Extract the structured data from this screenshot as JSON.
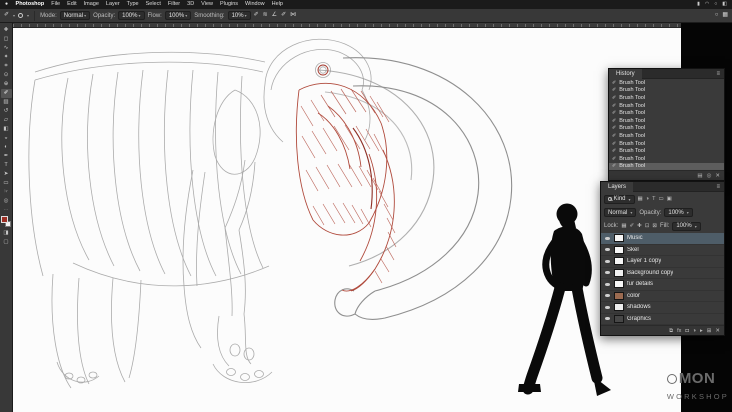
{
  "ui": {
    "caret": "▾",
    "panel_menu": "≡",
    "apple": "●"
  },
  "menu_bar": {
    "items": [
      "Photoshop",
      "File",
      "Edit",
      "Image",
      "Layer",
      "Type",
      "Select",
      "Filter",
      "3D",
      "View",
      "Plugins",
      "Window",
      "Help"
    ],
    "status_icons": [
      {
        "name": "battery-icon",
        "glyph": "▮"
      },
      {
        "name": "wifi-icon",
        "glyph": "◠"
      },
      {
        "name": "search-icon",
        "glyph": "○"
      },
      {
        "name": "control-center-icon",
        "glyph": "◧"
      }
    ]
  },
  "options_bar": {
    "tool_icon_glyph": "✐",
    "mode_label": "Mode:",
    "mode_value": "Normal",
    "opacity_label": "Opacity:",
    "opacity_value": "100%",
    "flow_label": "Flow:",
    "flow_value": "100%",
    "smoothing_label": "Smoothing:",
    "smoothing_value": "10%",
    "trailing_icons": [
      {
        "name": "pen-pressure-opacity-icon",
        "glyph": "✐"
      },
      {
        "name": "airbrush-icon",
        "glyph": "≋"
      },
      {
        "name": "brush-angle-icon",
        "glyph": "∠"
      },
      {
        "name": "pen-pressure-size-icon",
        "glyph": "✐"
      },
      {
        "name": "paint-symmetry-icon",
        "glyph": "⋈"
      }
    ],
    "right_icons": [
      {
        "name": "search-icon",
        "glyph": "○"
      },
      {
        "name": "workspace-switcher-icon",
        "glyph": "▦"
      }
    ]
  },
  "toolbar": {
    "tools": [
      {
        "name": "move-tool",
        "glyph": "✚"
      },
      {
        "name": "marquee-tool",
        "glyph": "◻"
      },
      {
        "name": "lasso-tool",
        "glyph": "∿"
      },
      {
        "name": "quick-selection-tool",
        "glyph": "✦"
      },
      {
        "name": "crop-tool",
        "glyph": "⌗"
      },
      {
        "name": "eyedropper-tool",
        "glyph": "⊙"
      },
      {
        "name": "healing-brush-tool",
        "glyph": "⊕"
      },
      {
        "name": "brush-tool",
        "glyph": "✐",
        "selected": true
      },
      {
        "name": "clone-stamp-tool",
        "glyph": "▨"
      },
      {
        "name": "history-brush-tool",
        "glyph": "↺"
      },
      {
        "name": "eraser-tool",
        "glyph": "▱"
      },
      {
        "name": "gradient-tool",
        "glyph": "◧"
      },
      {
        "name": "blur-tool",
        "glyph": "◒"
      },
      {
        "name": "dodge-tool",
        "glyph": "◐"
      },
      {
        "name": "pen-tool",
        "glyph": "✒"
      },
      {
        "name": "type-tool",
        "glyph": "T"
      },
      {
        "name": "path-selection-tool",
        "glyph": "➤"
      },
      {
        "name": "shape-tool",
        "glyph": "▭"
      },
      {
        "name": "hand-tool",
        "glyph": "☞"
      },
      {
        "name": "zoom-tool",
        "glyph": "◎"
      }
    ],
    "more_glyph": "⋯",
    "foreground_color": "#9c2f25",
    "background_color": "#f2f2f2",
    "extra_icons": [
      {
        "name": "quick-mask-icon",
        "glyph": "◨"
      },
      {
        "name": "screen-mode-icon",
        "glyph": "▢"
      }
    ]
  },
  "history_panel": {
    "title": "History",
    "entry_icon": "✐",
    "entries": [
      "Brush Tool",
      "Brush Tool",
      "Brush Tool",
      "Brush Tool",
      "Brush Tool",
      "Brush Tool",
      "Brush Tool",
      "Brush Tool",
      "Brush Tool",
      "Brush Tool",
      "Brush Tool",
      "Brush Tool"
    ],
    "footer_icons": [
      {
        "name": "new-document-from-state-icon",
        "glyph": "▤"
      },
      {
        "name": "new-snapshot-icon",
        "glyph": "◎"
      },
      {
        "name": "delete-state-icon",
        "glyph": "✕"
      }
    ]
  },
  "layers_panel": {
    "title": "Layers",
    "filter_label": "Kind",
    "filter_icons": [
      {
        "name": "filter-pixel-layers-icon",
        "glyph": "▦"
      },
      {
        "name": "filter-adjustment-layers-icon",
        "glyph": "◑"
      },
      {
        "name": "filter-type-layers-icon",
        "glyph": "T"
      },
      {
        "name": "filter-shape-layers-icon",
        "glyph": "▭"
      },
      {
        "name": "filter-smart-objects-icon",
        "glyph": "▣"
      }
    ],
    "blend_mode": "Normal",
    "opacity_label": "Opacity:",
    "opacity_value": "100%",
    "lock_label": "Lock:",
    "lock_icons": [
      {
        "name": "lock-transparent-pixels-icon",
        "glyph": "▦"
      },
      {
        "name": "lock-image-pixels-icon",
        "glyph": "✐"
      },
      {
        "name": "lock-position-icon",
        "glyph": "✚"
      },
      {
        "name": "lock-artboard-icon",
        "glyph": "⊡"
      },
      {
        "name": "lock-all-icon",
        "glyph": "⊠"
      }
    ],
    "fill_label": "Fill:",
    "fill_value": "100%",
    "layers": [
      {
        "name": "Music",
        "thumb": "#f5f5f5",
        "selected": true
      },
      {
        "name": "Skel",
        "thumb": "#f5f5f5",
        "selected": false
      },
      {
        "name": "Layer 1 copy",
        "thumb": "#f5f5f5",
        "selected": false
      },
      {
        "name": "Background copy",
        "thumb": "#f0f0f0",
        "selected": false
      },
      {
        "name": "fur details",
        "thumb": "#f5f5f5",
        "selected": false
      },
      {
        "name": "color",
        "thumb": "#9a6a50",
        "selected": false
      },
      {
        "name": "shadows",
        "thumb": "#ececec",
        "selected": false
      },
      {
        "name": "Graphics",
        "thumb": "#474747",
        "selected": false
      }
    ],
    "footer_icons": [
      {
        "name": "link-layers-icon",
        "glyph": "⧉"
      },
      {
        "name": "layer-style-icon",
        "glyph": "fx"
      },
      {
        "name": "layer-mask-icon",
        "glyph": "◘"
      },
      {
        "name": "adjustment-layer-icon",
        "glyph": "◑"
      },
      {
        "name": "layer-group-icon",
        "glyph": "▸"
      },
      {
        "name": "new-layer-icon",
        "glyph": "⊞"
      },
      {
        "name": "delete-layer-icon",
        "glyph": "✕"
      }
    ]
  },
  "watermark": {
    "line1": "MON",
    "line2": "WORKSHOP"
  }
}
